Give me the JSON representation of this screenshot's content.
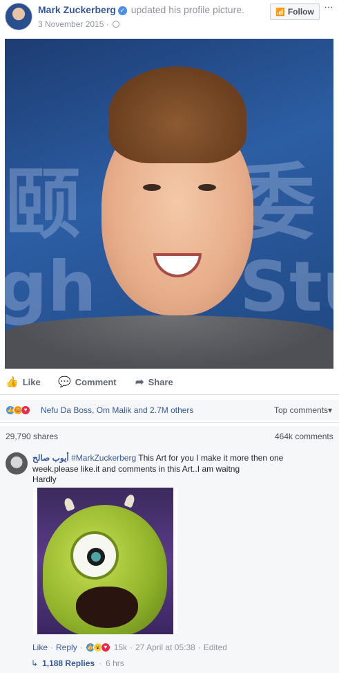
{
  "post": {
    "author": "Mark Zuckerberg",
    "action": "updated his profile picture.",
    "date": "3 November 2015",
    "separator": "·",
    "follow_label": "Follow",
    "more_label": "···"
  },
  "actions": {
    "like": "Like",
    "comment": "Comment",
    "share": "Share"
  },
  "reactions": {
    "summary": "Nefu Da Boss, Om Malik and 2.7M others",
    "sort_label": "Top comments",
    "sort_caret": "▾"
  },
  "stats": {
    "shares": "29,790 shares",
    "comments": "464k comments"
  },
  "comment": {
    "author": "أيوب صالح",
    "hashtag": "#MarkZuckerberg",
    "text": "This Art for you I make it more then one week.please like.it and comments in this Art..I am waitng",
    "line2": "Hardly",
    "like": "Like",
    "reply": "Reply",
    "reaction_count": "15k",
    "timestamp": "27 April at 05:38",
    "edited": "Edited",
    "sep": "·",
    "replies": "1,188 Replies",
    "replies_time": "6 hrs"
  },
  "photo_bg_text": [
    "颐",
    "委",
    "gh",
    "Stu"
  ],
  "icons": {
    "verified": "verified-badge-icon",
    "globe": "globe-icon",
    "rss": "rss-icon",
    "like": "thumbs-up-icon",
    "comment": "speech-bubble-icon",
    "share": "share-arrow-icon",
    "reply_arrow": "reply-arrow-icon"
  },
  "colors": {
    "link": "#365899",
    "muted": "#90949c",
    "like_blue": "#4a90e2",
    "angry": "#f25268",
    "wow": "#fcd354",
    "love": "#f0284a"
  }
}
